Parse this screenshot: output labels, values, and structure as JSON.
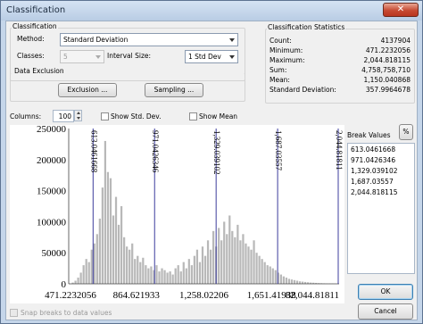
{
  "window": {
    "title": "Classification",
    "close_glyph": "✕"
  },
  "classification": {
    "group_label": "Classification",
    "method_label": "Method:",
    "method_value": "Standard Deviation",
    "classes_label": "Classes:",
    "classes_value": "5",
    "interval_label": "Interval Size:",
    "interval_value": "1 Std Dev"
  },
  "data_exclusion": {
    "group_label": "Data Exclusion",
    "exclusion_button": "Exclusion ...",
    "sampling_button": "Sampling ..."
  },
  "statistics": {
    "group_label": "Classification Statistics",
    "rows": [
      {
        "label": "Count:",
        "value": "4137904"
      },
      {
        "label": "Minimum:",
        "value": "471.2232056"
      },
      {
        "label": "Maximum:",
        "value": "2,044.818115"
      },
      {
        "label": "Sum:",
        "value": "4,758,758,710"
      },
      {
        "label": "Mean:",
        "value": "1,150.040868"
      },
      {
        "label": "Standard Deviation:",
        "value": "357.9964678"
      }
    ]
  },
  "histogram_controls": {
    "columns_label": "Columns:",
    "columns_value": "100",
    "show_std_dev": "Show Std. Dev.",
    "show_mean": "Show Mean"
  },
  "break_values": {
    "label": "Break Values",
    "percent_button": "%",
    "values": [
      "613.0461668",
      "971.0426346",
      "1,329.039102",
      "1,687.03557",
      "2,044.818115"
    ]
  },
  "buttons": {
    "ok": "OK",
    "cancel": "Cancel"
  },
  "snap_label": "Snap breaks to data values",
  "chart_data": {
    "type": "bar",
    "ylim": [
      0,
      250000
    ],
    "xlim": [
      471.2232056,
      2044.818115
    ],
    "y_ticks": [
      "250000",
      "200000",
      "150000",
      "100000",
      "50000",
      "0"
    ],
    "x_ticks": [
      {
        "label": "471.2232056",
        "value": 471.2232056
      },
      {
        "label": "864.621933",
        "value": 864.621933
      },
      {
        "label": "1,258.02206",
        "value": 1258.02206
      },
      {
        "label": "1,651.41938",
        "value": 1651.41938
      },
      {
        "label": "82,044.81811",
        "value": 2044.81811
      }
    ],
    "breaks": [
      613.0461668,
      971.0426346,
      1329.039102,
      1687.03557,
      2044.818115
    ],
    "break_labels": [
      "613.0461668",
      "971.0426346",
      "1,329.039102",
      "1,687.03557",
      "2,044.81811"
    ],
    "values": [
      0,
      2000,
      5000,
      10000,
      18000,
      30000,
      40000,
      35000,
      55000,
      65000,
      80000,
      105000,
      155000,
      230000,
      180000,
      170000,
      110000,
      140000,
      95000,
      125000,
      75000,
      60000,
      55000,
      65000,
      40000,
      45000,
      35000,
      42000,
      30000,
      25000,
      28000,
      22000,
      30000,
      20000,
      25000,
      22000,
      18000,
      20000,
      15000,
      25000,
      30000,
      20000,
      35000,
      25000,
      40000,
      30000,
      45000,
      55000,
      35000,
      60000,
      45000,
      70000,
      55000,
      85000,
      60000,
      90000,
      70000,
      100000,
      80000,
      110000,
      85000,
      75000,
      95000,
      70000,
      80000,
      65000,
      60000,
      55000,
      70000,
      50000,
      45000,
      40000,
      35000,
      30000,
      28000,
      25000,
      22000,
      18000,
      15000,
      12000,
      10000,
      8000,
      7000,
      6000,
      5000,
      4000,
      3500,
      3000,
      2500,
      2000,
      1800,
      1500,
      1200,
      1000,
      800,
      600,
      500,
      400,
      300,
      200
    ]
  }
}
